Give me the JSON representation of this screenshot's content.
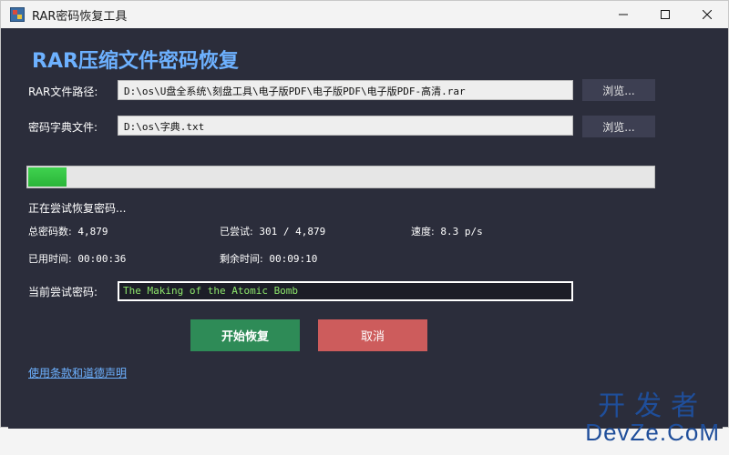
{
  "window": {
    "title": "RAR密码恢复工具"
  },
  "header": {
    "title": "RAR压缩文件密码恢复"
  },
  "rar_file": {
    "label": "RAR文件路径:",
    "value": "D:\\os\\U盘全系统\\刻盘工具\\电子版PDF\\电子版PDF\\电子版PDF-高清.rar",
    "browse_label": "浏览..."
  },
  "dictionary": {
    "label": "密码字典文件:",
    "value": "D:\\os\\字典.txt",
    "browse_label": "浏览..."
  },
  "progress": {
    "fraction": 0.0617
  },
  "status": {
    "message": "正在尝试恢复密码...",
    "total_label": "总密码数:",
    "total_value": "4,879",
    "tried_label": "已尝试:",
    "tried_value": "301 / 4,879",
    "speed_label": "速度:",
    "speed_value": "8.3 p/s",
    "elapsed_label": "已用时间:",
    "elapsed_value": "00:00:36",
    "remaining_label": "剩余时间:",
    "remaining_value": "00:09:10"
  },
  "current": {
    "label": "当前尝试密码:",
    "value": "The Making of the Atomic Bomb"
  },
  "actions": {
    "start_label": "开始恢复",
    "cancel_label": "取消"
  },
  "footer": {
    "link_label": "使用条款和道德声明"
  },
  "watermark": {
    "line1": "开发者",
    "line2": "DevZe.CoM"
  },
  "colors": {
    "window_background": "#2b2d3b",
    "heading": "#6db1ff",
    "progress_fill": "#2bb53a",
    "start_button": "#2e8b57",
    "cancel_button": "#cd5c5c",
    "current_password_text": "#8ee66c"
  }
}
